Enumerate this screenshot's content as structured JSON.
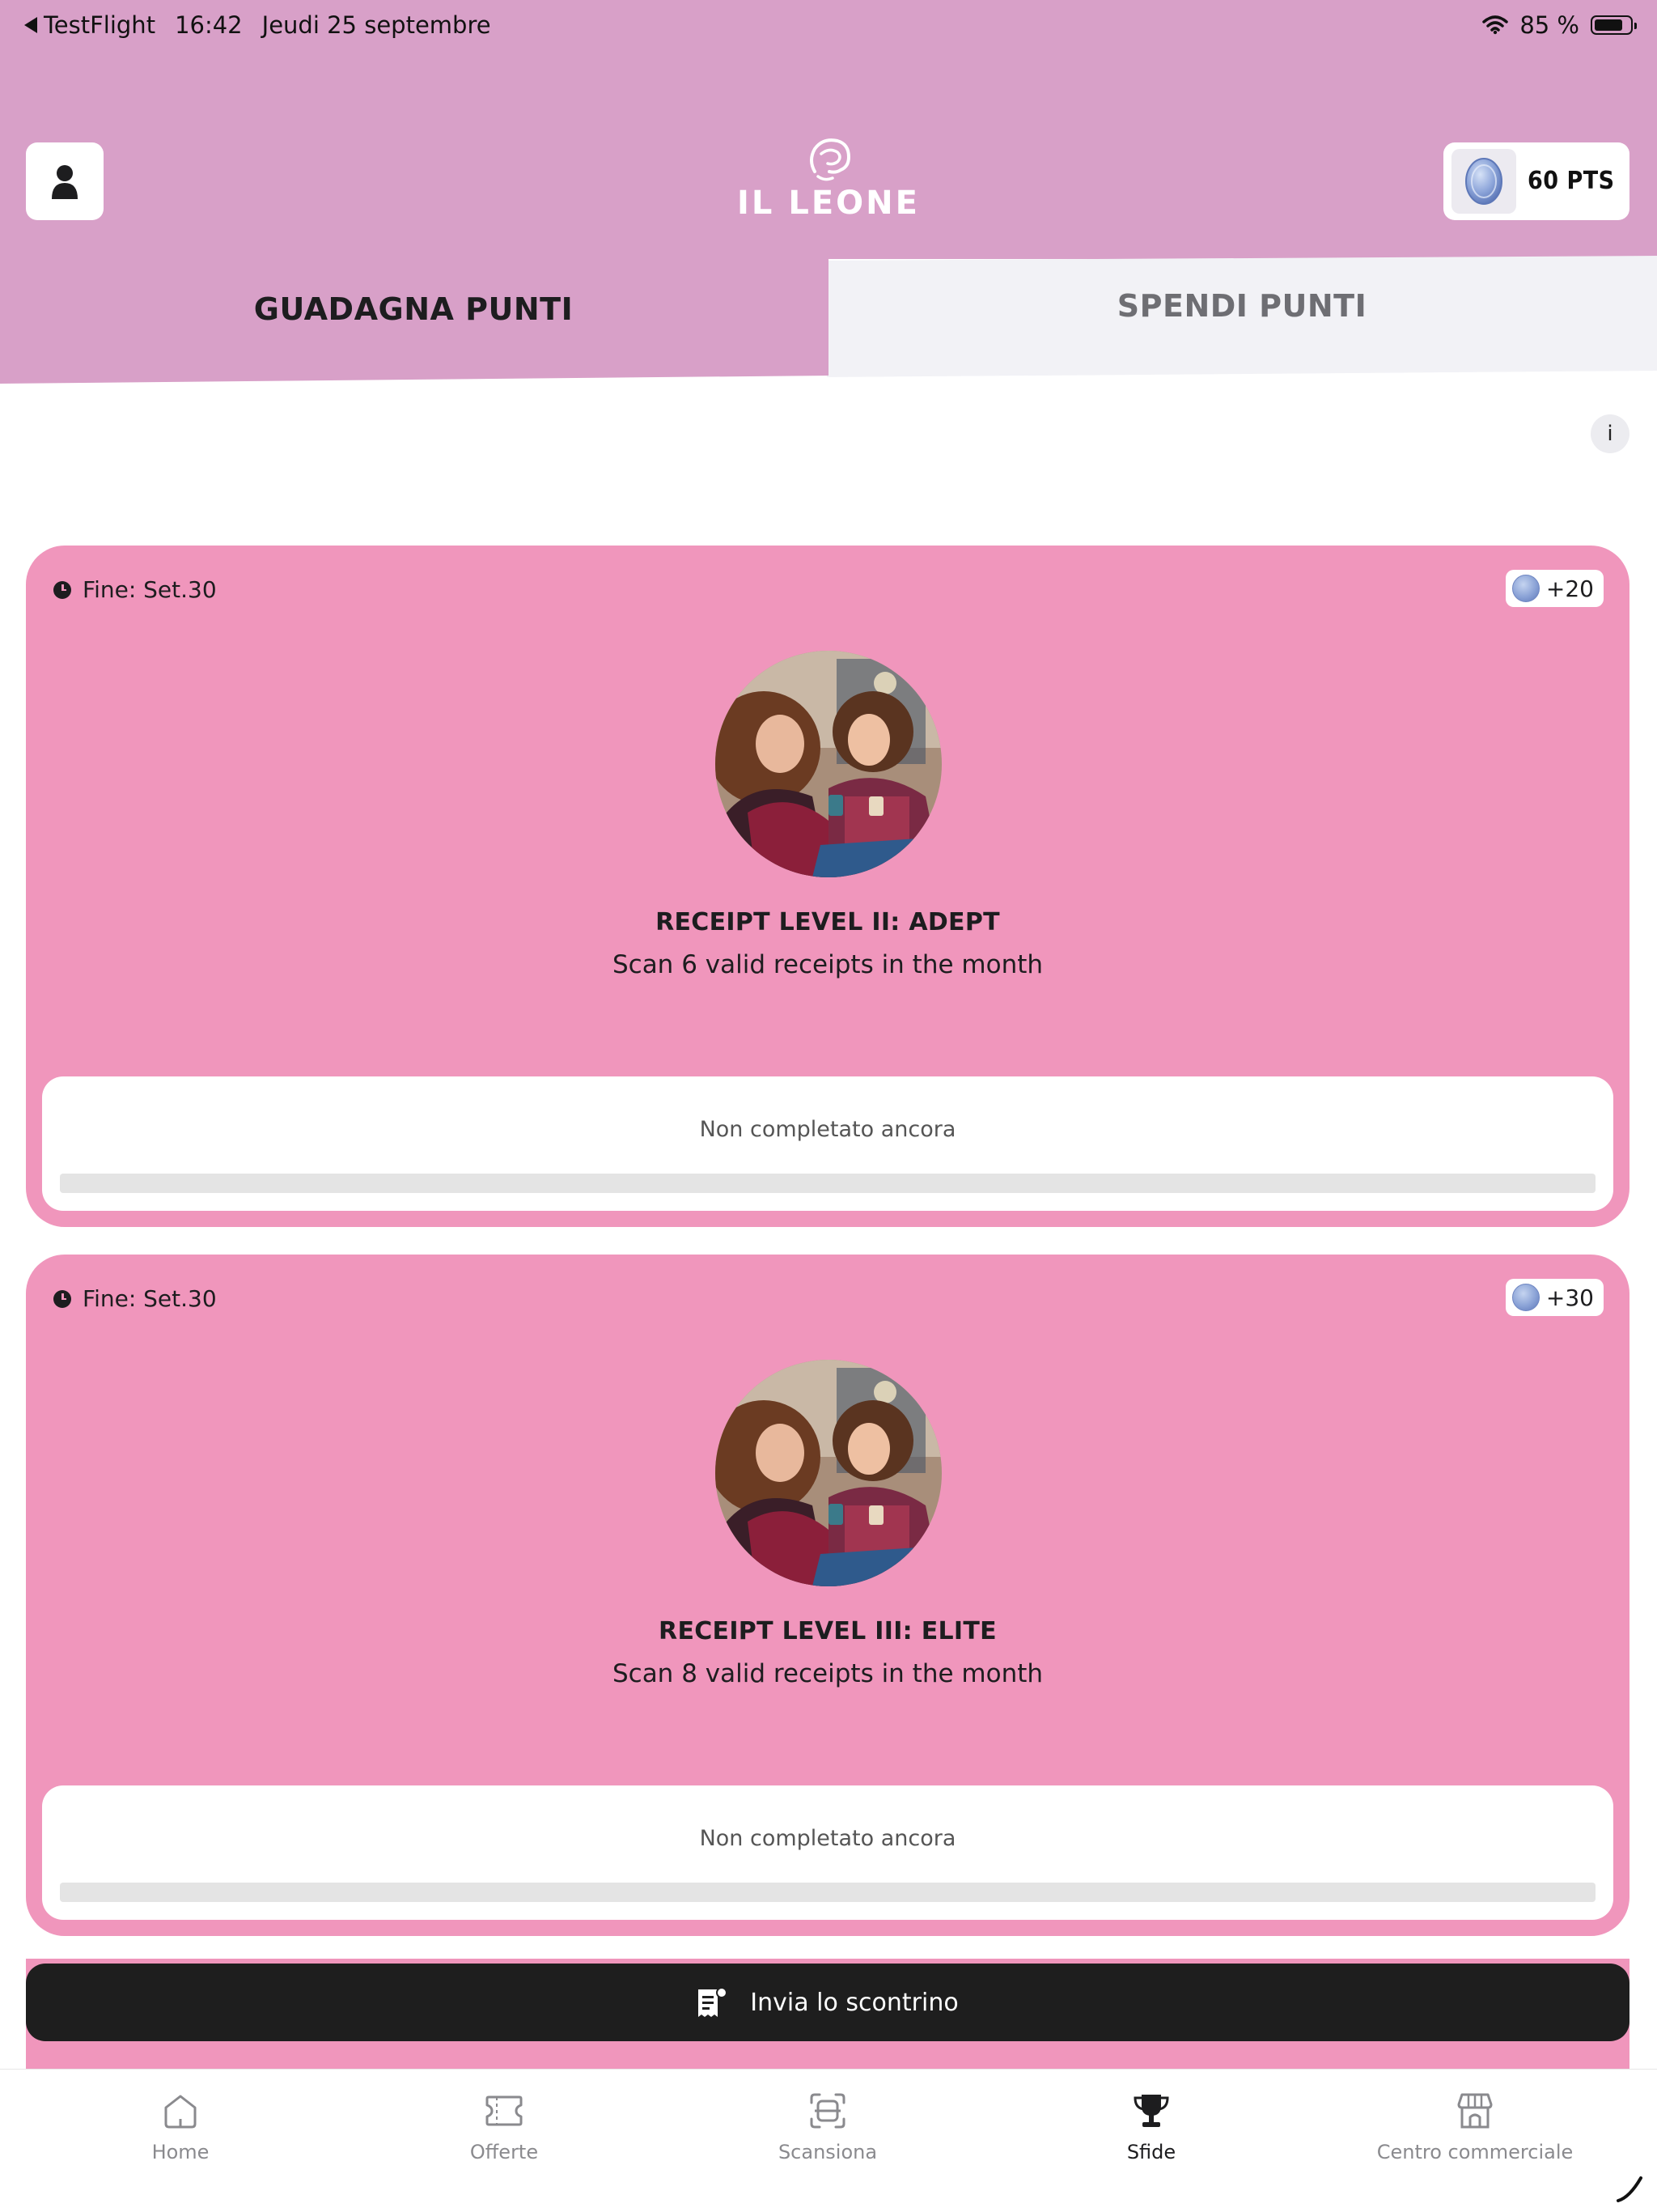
{
  "status_bar": {
    "back_app": "TestFlight",
    "time": "16:42",
    "date": "Jeudi 25 septembre",
    "battery_text": "85 %",
    "battery_level": 0.85
  },
  "header": {
    "brand": "IL LEONE",
    "points_label": "60 PTS"
  },
  "tabs": [
    {
      "label": "GUADAGNA PUNTI",
      "active": true
    },
    {
      "label": "SPENDI PUNTI",
      "active": false
    }
  ],
  "info_button": "i",
  "challenges": [
    {
      "deadline": "Fine: Set.30",
      "reward": "+20",
      "title": "RECEIPT LEVEL II: ADEPT",
      "description": "Scan 6 valid receipts in the month",
      "status": "Non completato ancora",
      "progress": 0
    },
    {
      "deadline": "Fine: Set.30",
      "reward": "+30",
      "title": "RECEIPT LEVEL III: ELITE",
      "description": "Scan 8 valid receipts in the month",
      "status": "Non completato ancora",
      "progress": 0
    }
  ],
  "send_receipt": {
    "label": "Invia lo scontrino"
  },
  "nav": [
    {
      "label": "Home",
      "icon": "home-icon"
    },
    {
      "label": "Offerte",
      "icon": "ticket-icon"
    },
    {
      "label": "Scansiona",
      "icon": "scan-icon"
    },
    {
      "label": "Sfide",
      "icon": "trophy-icon",
      "active": true
    },
    {
      "label": "Centro commerciale",
      "icon": "storefront-icon"
    }
  ],
  "colors": {
    "header_bg": "#d8a0c8",
    "card_bg": "#f096bc",
    "button_dark": "#1e1e1e",
    "inactive_tab": "#f2f2f6"
  }
}
